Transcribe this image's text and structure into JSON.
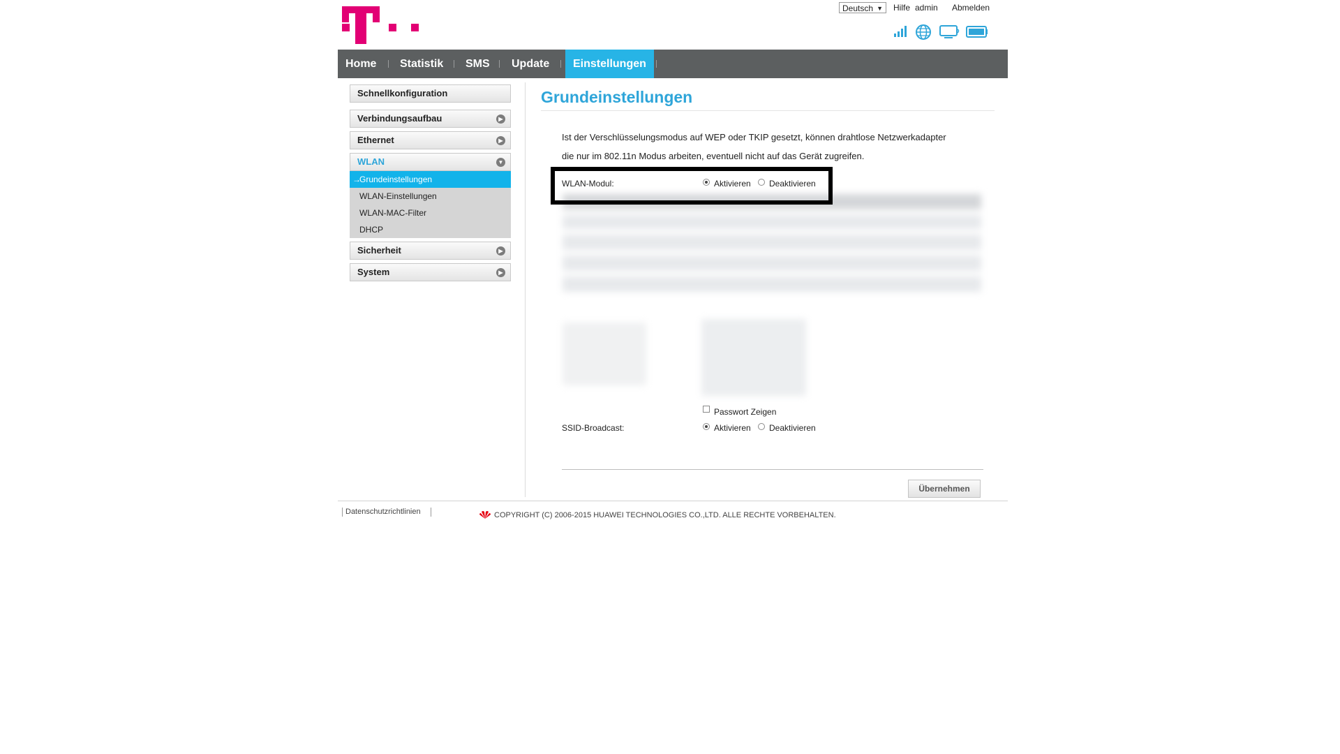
{
  "header": {
    "language": "Deutsch",
    "links": {
      "help": "Hilfe",
      "user": "admin",
      "logout": "Abmelden"
    },
    "brand_color": "#e20074",
    "status_icons": [
      "signal-icon",
      "globe-icon",
      "monitor-icon",
      "battery-icon"
    ]
  },
  "nav": {
    "items": [
      "Home",
      "Statistik",
      "SMS",
      "Update",
      "Einstellungen"
    ],
    "active": "Einstellungen",
    "active_color": "#27b4e6"
  },
  "sidebar": {
    "items": [
      "Schnellkonfiguration",
      "Verbindungsaufbau",
      "Ethernet",
      "WLAN",
      "Sicherheit",
      "System"
    ],
    "wlan_sub": [
      "Grundeinstellungen",
      "WLAN-Einstellungen",
      "WLAN-MAC-Filter",
      "DHCP"
    ],
    "active_prefix": "→",
    "accent_color": "#12b3ea"
  },
  "main": {
    "title": "Grundeinstellungen",
    "description_line1": "Ist der Verschlüsselungsmodus auf WEP oder TKIP gesetzt, können drahtlose Netzwerkadapter",
    "description_line2": "die nur im 802.11n Modus arbeiten, eventuell nicht auf das Gerät zugreifen.",
    "wlan_module": {
      "label": "WLAN-Modul:",
      "on": "Aktivieren",
      "off": "Deaktivieren",
      "selected": "Aktivieren"
    },
    "show_password": {
      "label": "Passwort Zeigen",
      "checked": false
    },
    "ssid_broadcast": {
      "label": "SSID-Broadcast:",
      "on": "Aktivieren",
      "off": "Deaktivieren",
      "selected": "Aktivieren"
    },
    "apply_label": "Übernehmen"
  },
  "footer": {
    "privacy_link": "Datenschutzrichtlinien",
    "copyright": "COPYRIGHT (C) 2006-2015 HUAWEI TECHNOLOGIES CO.,LTD. ALLE RECHTE VORBEHALTEN.",
    "logo_color": "#e60012"
  }
}
